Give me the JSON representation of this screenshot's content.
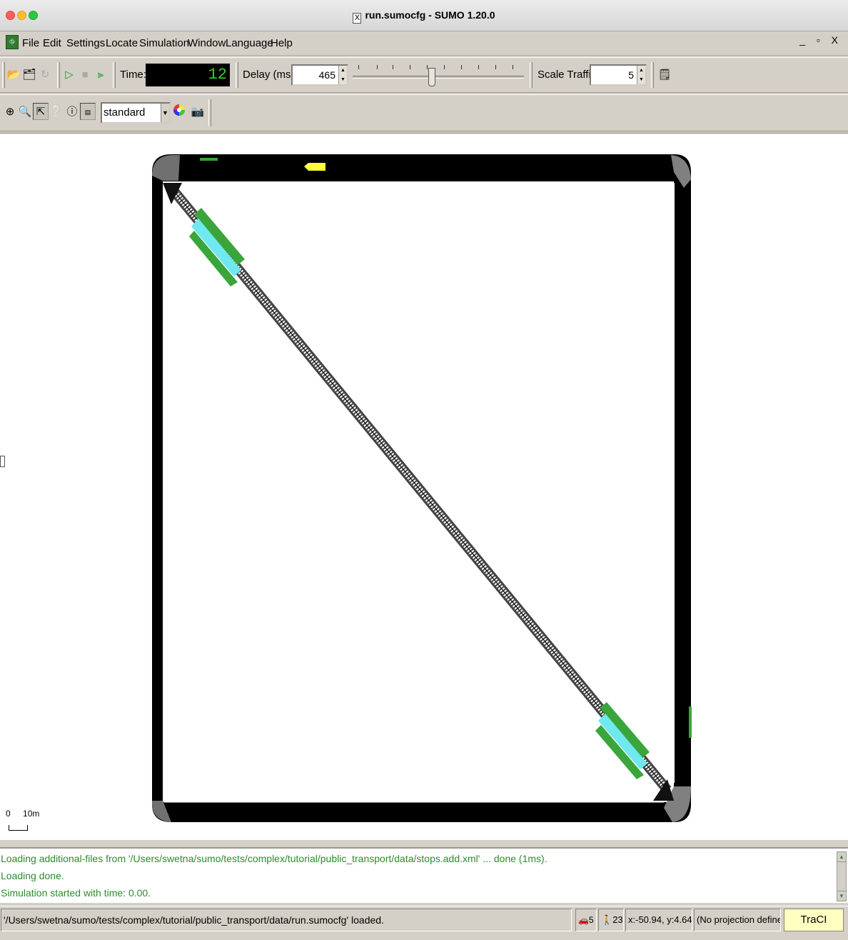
{
  "window": {
    "title": "run.sumocfg - SUMO 1.20.0",
    "controls": "_ ▫ X"
  },
  "menu": {
    "items": [
      "File",
      "Edit",
      "Settings",
      "Locate",
      "Simulation",
      "Window",
      "Language",
      "Help"
    ]
  },
  "toolbar": {
    "time_label": "Time:",
    "time_value": "12",
    "delay_label": "Delay (ms):",
    "delay_value": "465",
    "scale_traffic_label": "Scale Traffic:",
    "scale_traffic_value": "5"
  },
  "view_toolbar": {
    "scheme_selected": "standard"
  },
  "canvas": {
    "scale_label_zero": "0",
    "scale_label_length": "10m"
  },
  "messages": [
    "Loading additional-files from '/Users/swetna/sumo/tests/complex/tutorial/public_transport/data/stops.add.xml' ... done (1ms).",
    "Loading done.",
    "Simulation started with time: 0.00."
  ],
  "status": {
    "message": "'/Users/swetna/sumo/tests/complex/tutorial/public_transport/data/run.sumocfg' loaded.",
    "vehicle_count": "5",
    "person_count": "23",
    "coords": "x:-50.94, y:4.64",
    "projection": "(No projection defined)",
    "traci": "TraCI"
  },
  "colors": {
    "message_green": "#2e8b2e",
    "bus_stop_green": "#3aa53a",
    "platform_cyan": "#6fe8f0",
    "vehicle_yellow": "#ffff40",
    "road_black": "#000000"
  }
}
